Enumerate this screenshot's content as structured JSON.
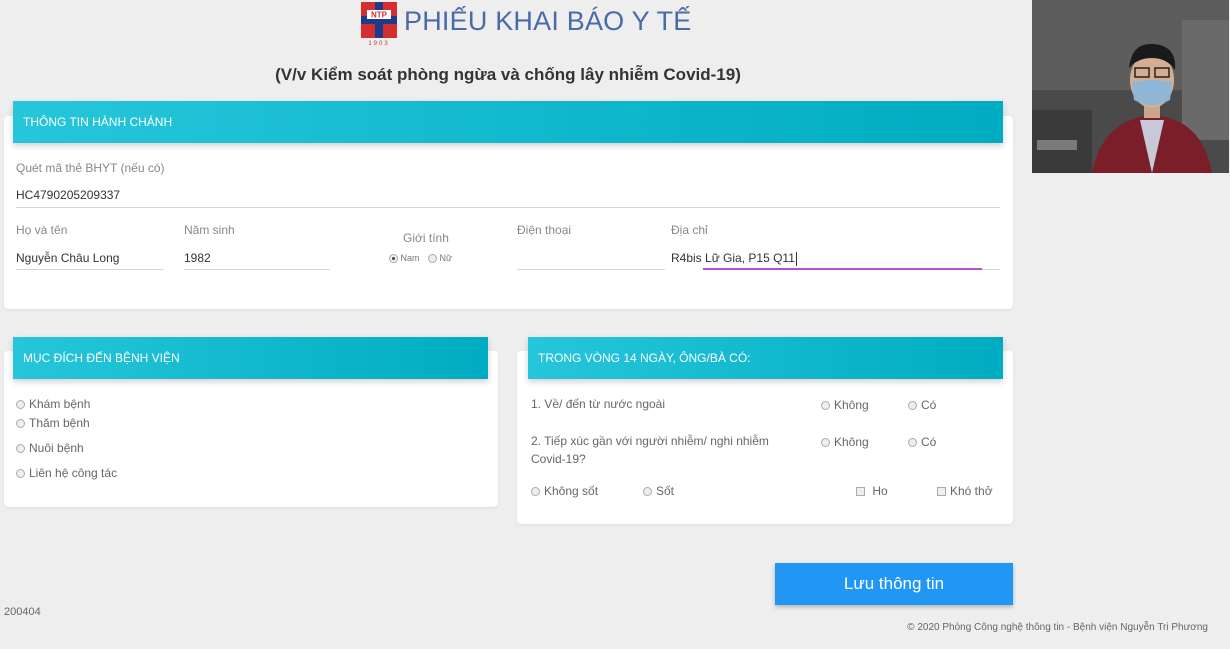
{
  "header": {
    "logo_text": "NTP",
    "logo_year": "1903",
    "title": "PHIẾU KHAI BÁO Y TẾ",
    "subtitle": "(V/v Kiểm soát phòng ngừa và chống lây nhiễm Covid-19)"
  },
  "admin": {
    "section_title": "THÔNG TIN HÀNH CHÁNH",
    "bhyt_label": "Quét mã thẻ BHYT (nếu có)",
    "bhyt_value": "HC4790205209337",
    "name_label": "Họ và tên",
    "name_value": "Nguyễn Châu Long",
    "birth_label": "Năm sinh",
    "birth_value": "1982",
    "gender_label": "Giới tính",
    "gender_male": "Nam",
    "gender_female": "Nữ",
    "gender_selected": "Nam",
    "phone_label": "Điện thoại",
    "phone_value": "",
    "address_label": "Địa chỉ",
    "address_value": "R4bis Lữ Gia, P15 Q11"
  },
  "purpose": {
    "section_title": "MỤC ĐÍCH ĐẾN BỆNH VIỆN",
    "options": [
      "Khám bệnh",
      "Thăm bệnh",
      "Nuôi bệnh",
      "Liên hệ công tác"
    ]
  },
  "exposure": {
    "section_title": "TRONG VÒNG 14 NGÀY, ÔNG/BÀ CÓ:",
    "q1_text": "1. Về/ đến từ nước ngoài",
    "q2_line1": "2. Tiếp xúc gần với người nhiễm/ nghi nhiễm",
    "q2_line2": "Covid-19?",
    "no_label": "Không",
    "yes_label": "Có",
    "fever_no": "Không sốt",
    "fever_yes": "Sốt",
    "cough": "Ho",
    "breath": "Khó thở"
  },
  "actions": {
    "save_label": "Lưu thông tin"
  },
  "footer": {
    "code": "200404",
    "copyright": "© 2020 Phòng Công nghệ thông tin - Bệnh viện Nguyễn Tri Phương"
  },
  "colors": {
    "band": "#00acc1",
    "save": "#2196f3",
    "title": "#4a6aa8"
  }
}
